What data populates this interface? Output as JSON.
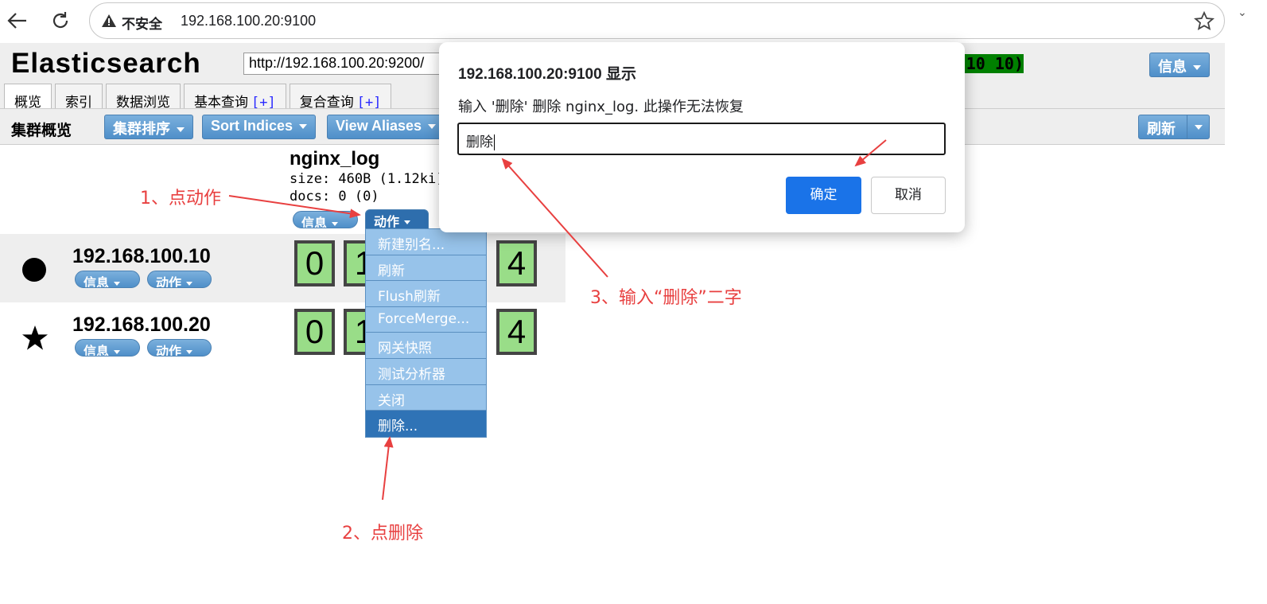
{
  "browser": {
    "security_label": "不安全",
    "url": "192.168.100.20:9100"
  },
  "app": {
    "title": "Elasticsearch",
    "connect_url": "http://192.168.100.20:9200/",
    "health_text": "(10 of 10)",
    "health_color": "#008000",
    "info_label": "信息"
  },
  "tabs": [
    {
      "label": "概览",
      "plus": ""
    },
    {
      "label": "索引",
      "plus": ""
    },
    {
      "label": "数据浏览",
      "plus": ""
    },
    {
      "label": "基本查询",
      "plus": "[+]"
    },
    {
      "label": "复合查询",
      "plus": "[+]"
    }
  ],
  "toolbar": {
    "title": "集群概览",
    "cluster_sort": "集群排序",
    "sort_indices": "Sort Indices",
    "view_aliases": "View Aliases",
    "refresh": "刷新"
  },
  "index": {
    "name": "nginx_log",
    "size": "size: 460B (1.12ki)",
    "docs": "docs: 0 (0)",
    "info_label": "信息",
    "action_label": "动作"
  },
  "nodes": [
    {
      "name": "192.168.100.10",
      "info": "信息",
      "action": "动作",
      "shards": [
        "0",
        "1",
        "4"
      ]
    },
    {
      "name": "192.168.100.20",
      "info": "信息",
      "action": "动作",
      "shards": [
        "0",
        "1",
        "4"
      ]
    }
  ],
  "action_menu": [
    "新建别名...",
    "刷新",
    "Flush刷新",
    "ForceMerge...",
    "网关快照",
    "测试分析器",
    "关闭",
    "删除..."
  ],
  "dialog": {
    "title": "192.168.100.20:9100 显示",
    "message": "输入 '删除'  删除 nginx_log. 此操作无法恢复",
    "input_value": "删除",
    "ok": "确定",
    "cancel": "取消"
  },
  "annotations": {
    "step1": "1、点动作",
    "step2": "2、点删除",
    "step3": "3、输入“删除”二字"
  },
  "colors": {
    "annotation": "#e84040",
    "accent_button": "#1a73e8",
    "shard_fill": "#99dd88",
    "menu_bg": "#97c3ea",
    "menu_selected": "#2f73b6"
  }
}
